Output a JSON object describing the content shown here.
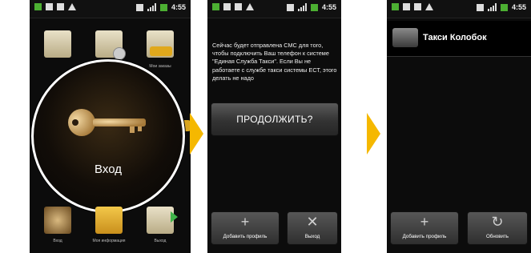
{
  "status_bar": {
    "time": "4:55"
  },
  "screen1": {
    "login_label": "Вход",
    "bottom_items": [
      "Вход",
      "Моя информация",
      "Выход"
    ],
    "top_right_label": "Мои заказы"
  },
  "screen2": {
    "message": "Сейчас будет отправлена СМС для того, чтобы подключить Ваш телефон к системе \"Единая Служба Такси\". Если Вы не работаете с службе такси системы ЕСТ, этого делать не надо",
    "continue_button": "ПРОДОЛЖИТЬ?",
    "add_profile_label": "Добавить профиль",
    "exit_label": "Выход",
    "add_symbol": "+",
    "exit_symbol": "✕"
  },
  "screen3": {
    "list_title": "Такси Колобок",
    "add_profile_label": "Добавить профиль",
    "refresh_label": "Обновить",
    "add_symbol": "+",
    "refresh_symbol": "↻"
  },
  "colors": {
    "accent_arrow": "#f5b800",
    "status_green": "#4caf32"
  }
}
